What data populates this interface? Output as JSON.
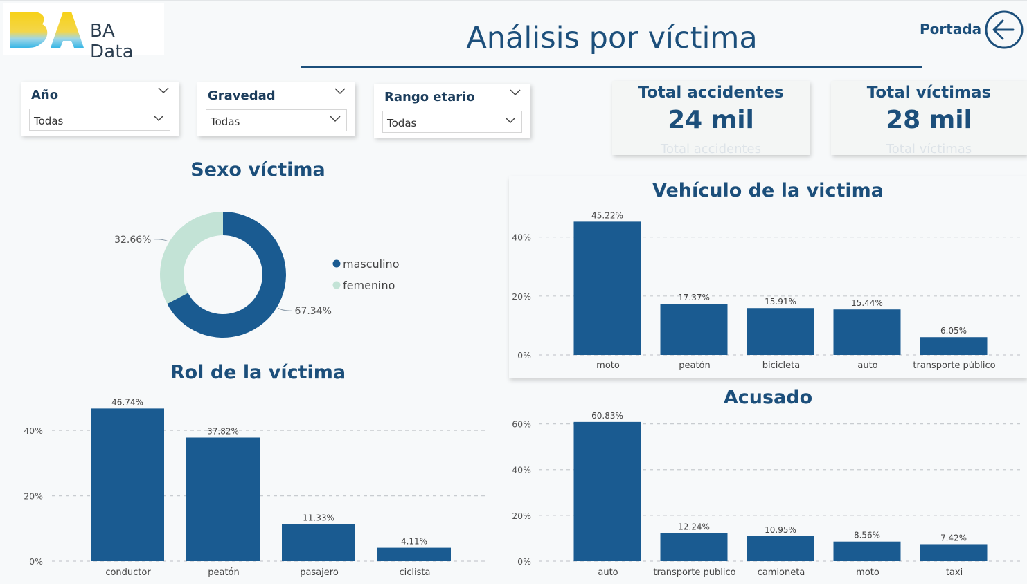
{
  "header": {
    "logo_text": "BA Data",
    "page_title": "Análisis por víctima",
    "portada_label": "Portada"
  },
  "filters": [
    {
      "label": "Año",
      "value": "Todas"
    },
    {
      "label": "Gravedad",
      "value": "Todas"
    },
    {
      "label": "Rango etario",
      "value": "Todas"
    }
  ],
  "kpis": [
    {
      "label": "Total accidentes",
      "value": "24 mil",
      "ghost": "Total accidentes"
    },
    {
      "label": "Total víctimas",
      "value": "28 mil",
      "ghost": "Total víctimas"
    }
  ],
  "colors": {
    "primary": "#1a5b91",
    "secondary": "#c3e3d6",
    "text": "#1c4f7b"
  },
  "chart_data": [
    {
      "id": "sexo",
      "type": "pie",
      "title": "Sexo víctima",
      "labels": [
        "masculino",
        "femenino"
      ],
      "values": [
        67.34,
        32.66
      ],
      "value_labels": [
        "67.34%",
        "32.66%"
      ],
      "colors": [
        "#1a5b91",
        "#c3e3d6"
      ],
      "legend": "right"
    },
    {
      "id": "rol",
      "type": "bar",
      "title": "Rol de la víctima",
      "categories": [
        "conductor",
        "peatón",
        "pasajero",
        "ciclista"
      ],
      "values": [
        46.74,
        37.82,
        11.33,
        4.11
      ],
      "value_labels": [
        "46.74%",
        "37.82%",
        "11.33%",
        "4.11%"
      ],
      "yticks": [
        "0%",
        "20%",
        "40%"
      ],
      "ytick_values": [
        0,
        20,
        40
      ],
      "ylim": [
        0,
        50
      ],
      "grid": true
    },
    {
      "id": "vehiculo",
      "type": "bar",
      "title": "Vehículo de la victima",
      "categories": [
        "moto",
        "peatón",
        "bicicleta",
        "auto",
        "transporte público"
      ],
      "values": [
        45.22,
        17.37,
        15.91,
        15.44,
        6.05
      ],
      "value_labels": [
        "45.22%",
        "17.37%",
        "15.91%",
        "15.44%",
        "6.05%"
      ],
      "yticks": [
        "0%",
        "20%",
        "40%"
      ],
      "ytick_values": [
        0,
        20,
        40
      ],
      "ylim": [
        0,
        50
      ],
      "grid": true
    },
    {
      "id": "acusado",
      "type": "bar",
      "title": "Acusado",
      "categories": [
        "auto",
        "transporte publico",
        "camioneta",
        "moto",
        "taxi"
      ],
      "values": [
        60.83,
        12.24,
        10.95,
        8.56,
        7.42
      ],
      "value_labels": [
        "60.83%",
        "12.24%",
        "10.95%",
        "8.56%",
        "7.42%"
      ],
      "yticks": [
        "0%",
        "20%",
        "40%",
        "60%"
      ],
      "ytick_values": [
        0,
        20,
        40,
        60
      ],
      "ylim": [
        0,
        62
      ],
      "grid": true
    }
  ]
}
